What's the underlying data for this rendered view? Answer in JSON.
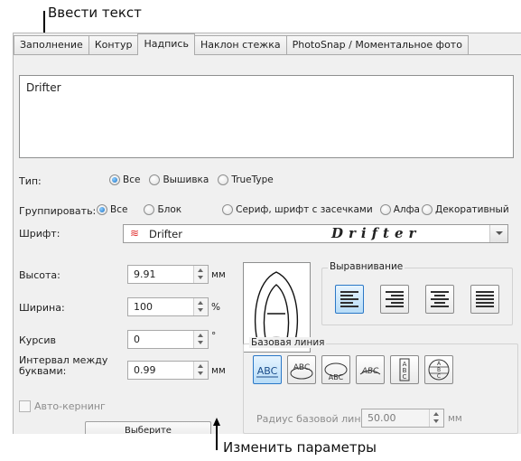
{
  "annotations": {
    "top": "Ввести текст",
    "bottom": "Изменить параметры"
  },
  "tabs": [
    {
      "label": "Заполнение",
      "active": false
    },
    {
      "label": "Контур",
      "active": false
    },
    {
      "label": "Надпись",
      "active": true
    },
    {
      "label": "Наклон стежка",
      "active": false
    },
    {
      "label": "PhotoSnap / Моментальное фото",
      "active": false
    }
  ],
  "text_input": {
    "value": "Drifter"
  },
  "type": {
    "label": "Тип:",
    "options": [
      "Все",
      "Вышивка",
      "TrueType"
    ],
    "selected": "Все"
  },
  "group": {
    "label": "Группировать:",
    "options": [
      "Все",
      "Блок",
      "Сериф, шрифт с засечками",
      "Алфа",
      "Декоративный"
    ],
    "selected": "Все"
  },
  "font": {
    "label": "Шрифт:",
    "value": "Drifter",
    "preview": "Drifter",
    "icon": "zigzag-icon"
  },
  "height": {
    "label": "Высота:",
    "value": "9.91",
    "unit": "мм"
  },
  "width": {
    "label": "Ширина:",
    "value": "100",
    "unit": "%"
  },
  "italic": {
    "label": "Курсив",
    "value": "0",
    "unit": "°"
  },
  "spacing": {
    "label": "Интервал между буквами:",
    "value": "0.99",
    "unit": "мм"
  },
  "auto_kerning": {
    "label": "Авто-кернинг",
    "checked": false,
    "enabled": false
  },
  "alignment": {
    "title": "Выравнивание",
    "options": [
      "left",
      "right",
      "center",
      "justify"
    ],
    "selected": "left"
  },
  "baseline": {
    "title": "Базовая линия",
    "options": [
      "ABC",
      "ABC",
      "ABC",
      "ABC",
      "ABC",
      "ABC"
    ],
    "selected": 0,
    "radius_label": "Радиус базовой линии:",
    "radius_value": "50.00",
    "radius_unit": "мм"
  },
  "bottom_button": {
    "label": "Выберите"
  }
}
